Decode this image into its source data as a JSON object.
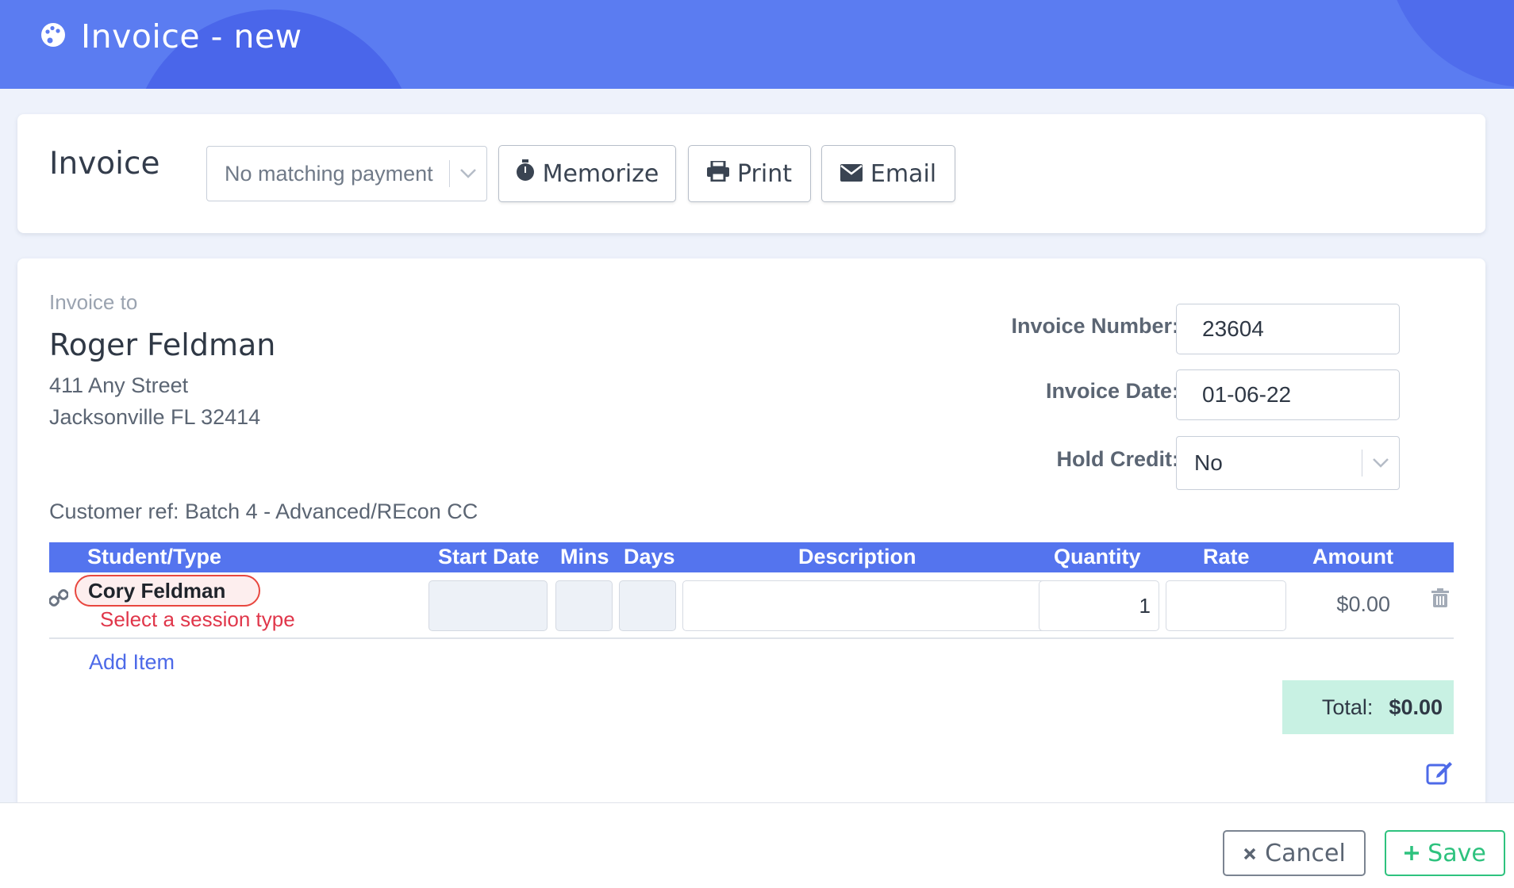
{
  "header": {
    "title": "Invoice - new",
    "icon": "palette-icon"
  },
  "toolbar": {
    "heading": "Invoice",
    "payment_select": "No matching payment",
    "memorize_label": "Memorize",
    "print_label": "Print",
    "email_label": "Email"
  },
  "invoice": {
    "to_label": "Invoice to",
    "customer_name": "Roger Feldman",
    "address_line1": "411 Any Street",
    "address_line2": "Jacksonville FL 32414",
    "customer_ref": "Customer ref: Batch 4 - Advanced/REcon CC",
    "number_label": "Invoice Number:",
    "number_value": "23604",
    "date_label": "Invoice Date:",
    "date_value": "01-06-22",
    "hold_label": "Hold Credit:",
    "hold_value": "No"
  },
  "table": {
    "columns": [
      "Student/Type",
      "Start Date",
      "Mins",
      "Days",
      "Description",
      "Quantity",
      "Rate",
      "Amount"
    ],
    "rows": [
      {
        "student": "Cory Feldman",
        "error": "Select a session type",
        "start_date": "",
        "mins": "",
        "days": "",
        "description": "",
        "quantity": "1",
        "rate": "",
        "amount": "$0.00"
      }
    ],
    "add_item": "Add Item",
    "total_label": "Total:",
    "total_value": "$0.00"
  },
  "footer": {
    "cancel_label": "Cancel",
    "save_label": "Save"
  },
  "colors": {
    "header": "#5b7cf1",
    "accent": "#5474ee",
    "error": "#e0364a",
    "success": "#2ec27e",
    "total_bg": "#c8f1e3"
  }
}
